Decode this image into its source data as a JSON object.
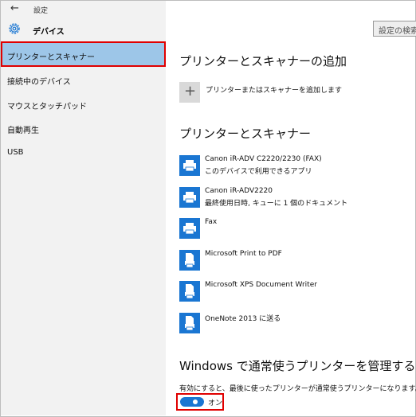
{
  "window": {
    "title": "設定",
    "back_icon": "back-arrow-icon"
  },
  "header": {
    "title": "デバイス",
    "icon": "gear-icon"
  },
  "search": {
    "placeholder": "設定の検索"
  },
  "sidebar": {
    "items": [
      {
        "label": "プリンターとスキャナー",
        "selected": true
      },
      {
        "label": "接続中のデバイス"
      },
      {
        "label": "マウスとタッチパッド"
      },
      {
        "label": "自動再生"
      },
      {
        "label": "USB"
      }
    ]
  },
  "main": {
    "add_section": {
      "title": "プリンターとスキャナーの追加",
      "add_label": "プリンターまたはスキャナーを追加します",
      "add_icon": "plus-icon"
    },
    "list_section": {
      "title": "プリンターとスキャナー",
      "devices": [
        {
          "name": "Canon iR-ADV C2220/2230 (FAX)",
          "status": "このデバイスで利用できるアプリ",
          "icon": "printer-icon"
        },
        {
          "name": "Canon iR-ADV2220",
          "status": "最終使用日時, キューに 1 個のドキュメント",
          "icon": "printer-icon"
        },
        {
          "name": "Fax",
          "status": "",
          "icon": "printer-icon"
        },
        {
          "name": "Microsoft Print to PDF",
          "status": "",
          "icon": "document-printer-icon"
        },
        {
          "name": "Microsoft XPS Document Writer",
          "status": "",
          "icon": "document-printer-icon"
        },
        {
          "name": "OneNote 2013 に送る",
          "status": "",
          "icon": "document-printer-icon"
        }
      ]
    },
    "default_section": {
      "title": "Windows で通常使うプリンターを管理する",
      "description": "有効にすると、最後に使ったプリンターが通常使うプリンターになります。",
      "toggle": {
        "state": "on",
        "label": "オン"
      }
    }
  },
  "colors": {
    "accent": "#1a76d2",
    "selected_bg": "#9dc6e8",
    "highlight_box": "#e00000",
    "sidebar_bg": "#f2f2f2"
  }
}
